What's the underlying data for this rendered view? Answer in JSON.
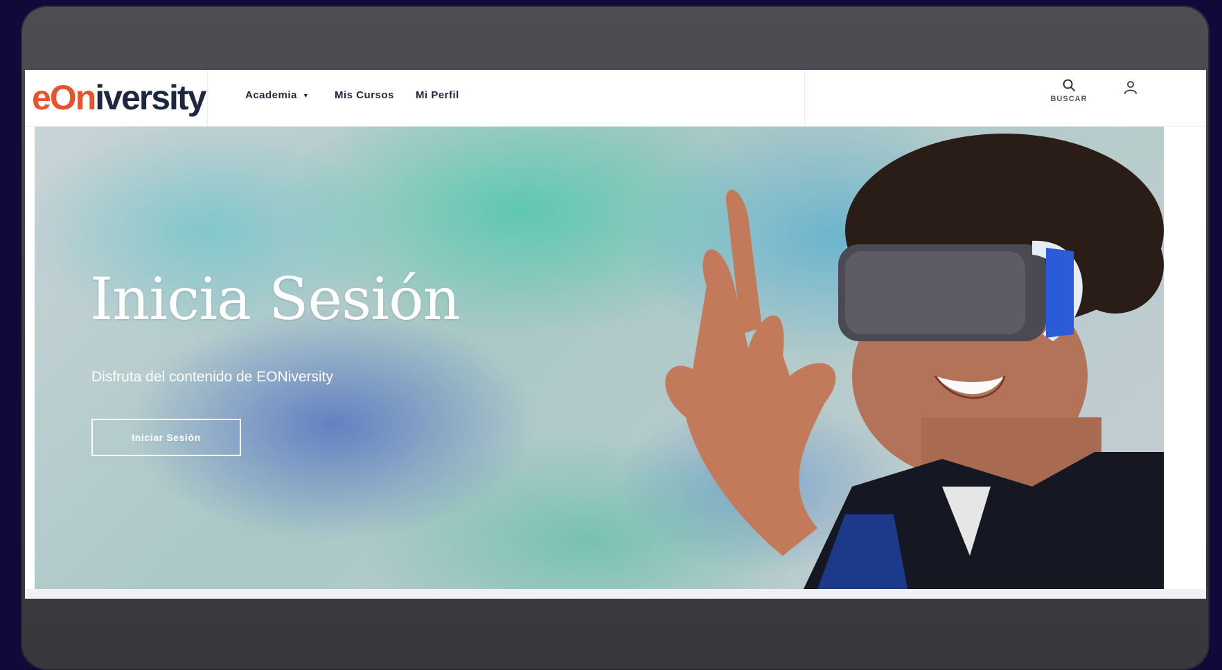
{
  "brand": {
    "logo_eon": "eOn",
    "logo_rest": "iversity",
    "accent_color": "#e8532a",
    "dark_color": "#1d2742"
  },
  "nav": {
    "items": [
      {
        "label": "Academia",
        "has_dropdown": true
      },
      {
        "label": "Mis Cursos"
      },
      {
        "label": "Mi Perfil"
      }
    ],
    "search_label": "BUSCAR",
    "search_icon": "search-icon",
    "user_icon": "user-icon"
  },
  "hero": {
    "title": "Inicia Sesión",
    "subtitle": "Disfruta del contenido de EONiversity",
    "button_label": "Iniciar Sesión"
  }
}
